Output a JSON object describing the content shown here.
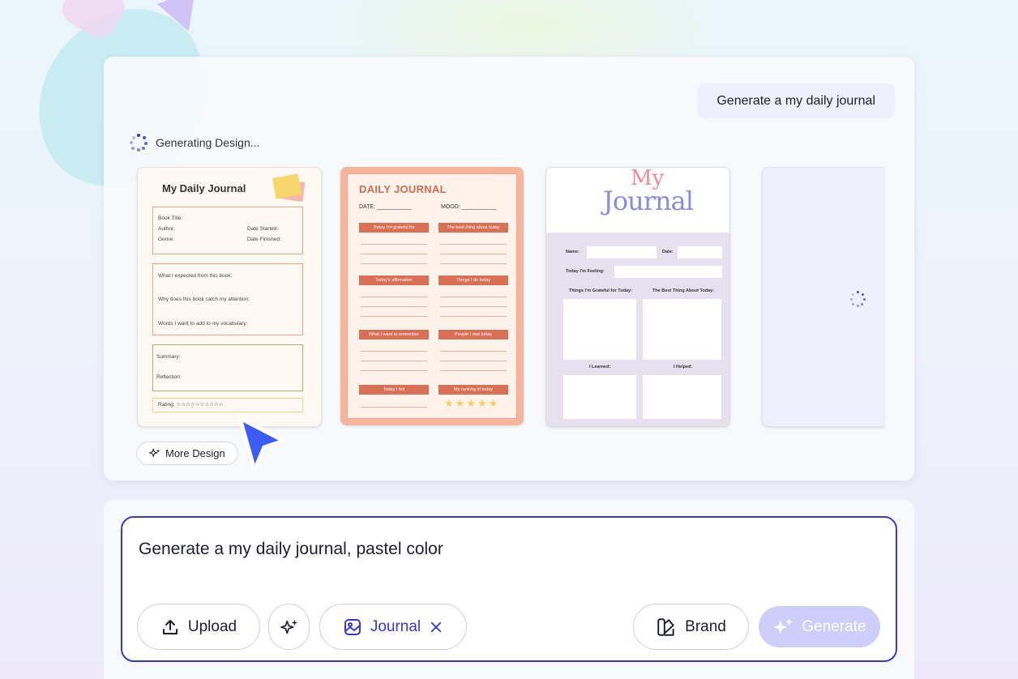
{
  "chat": {
    "prompt_bubble": "Generate a my daily journal"
  },
  "status": {
    "text": "Generating Design..."
  },
  "card1": {
    "title": "My Daily Journal",
    "book_title": "Book Title:",
    "author": "Author:",
    "genre": "Genre:",
    "date_started": "Date Started:",
    "date_finished": "Date Finished:",
    "expected": "What I expected from this book:",
    "attention": "Why does this book catch my attention:",
    "words": "Words I want to add to my vocabulary:",
    "summary": "Summary:",
    "reflection": "Reflection:",
    "rating": "Rating: ☆☆☆☆☆☆☆☆☆☆"
  },
  "card2": {
    "title": "DAILY JOURNAL",
    "date": "DATE: ___________",
    "mood": "MOOD: ___________",
    "bars": [
      "Today I'm grateful for",
      "The best thing about today",
      "Today's affirmation",
      "Things I do today",
      "What I want to remember",
      "People I met today",
      "Today I felt",
      "My ranking of today"
    ],
    "stars": "★★★★★"
  },
  "card3": {
    "my": "My",
    "journal": "Journal",
    "name": "Name:",
    "date": "Date:",
    "feeling": "Today I'm Feeling:",
    "grateful": "Things I'm Grateful for Today:",
    "best": "The Best Thing About Today:",
    "learned": "I Learned:",
    "helped": "I Helped:"
  },
  "more_design": {
    "label": "More Design"
  },
  "composer": {
    "text": "Generate a my daily journal, pastel color",
    "upload_label": "Upload",
    "journal_label": "Journal",
    "brand_label": "Brand",
    "generate_label": "Generate"
  },
  "colors": {
    "accent": "#3a35d6",
    "generate_bg": "#cfcdfa"
  }
}
